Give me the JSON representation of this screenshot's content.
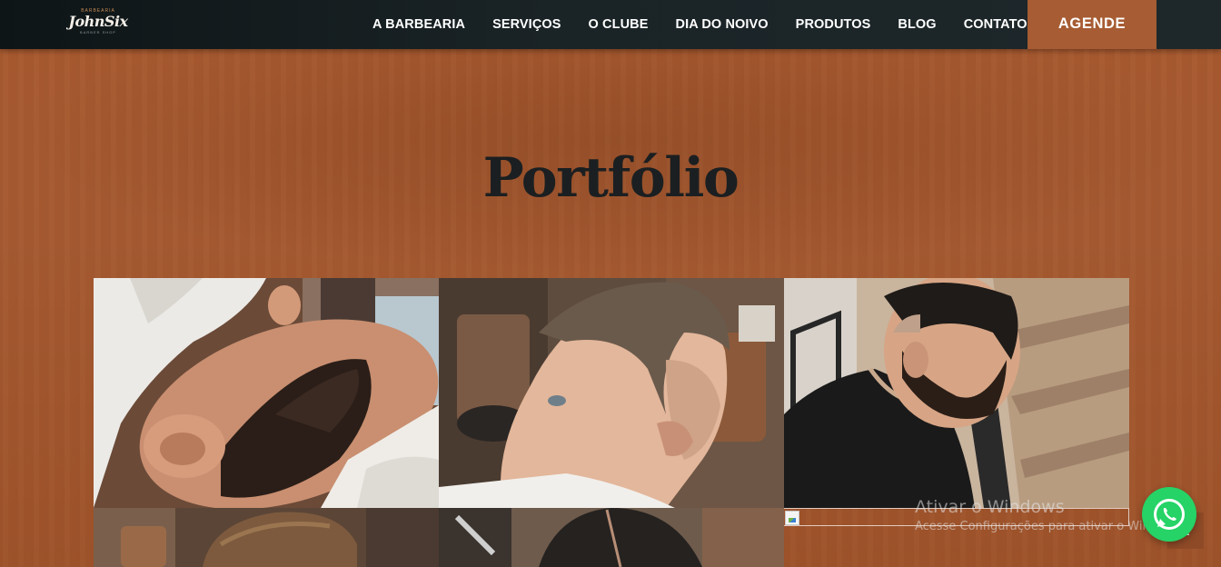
{
  "header": {
    "logo": {
      "top": "BARBEARIA",
      "word": "JohnSix",
      "bottom": "BARBER SHOP"
    },
    "nav": [
      "A BARBEARIA",
      "SERVIÇOS",
      "O CLUBE",
      "DIA DO NOIVO",
      "PRODUTOS",
      "BLOG",
      "CONTATO"
    ],
    "cta": "AGENDE"
  },
  "page": {
    "title": "Portfólio"
  },
  "gallery": {
    "items": [
      "beard-trim-towel",
      "skin-fade-side",
      "beard-client-barber-chair",
      "haircut-top",
      "slick-part-haircut"
    ]
  },
  "watermark": {
    "title": "Ativar o Windows",
    "subtitle": "Acesse Configurações para ativar o Windows."
  },
  "colors": {
    "background": "#a65a31",
    "header": "#1a2326",
    "cta": "#a75c33",
    "whatsapp": "#25d366",
    "title": "#1b1f21"
  },
  "icons": {
    "whatsapp": "whatsapp-icon",
    "scroll_top": "chevron-up-icon",
    "broken_image": "broken-image-icon"
  }
}
